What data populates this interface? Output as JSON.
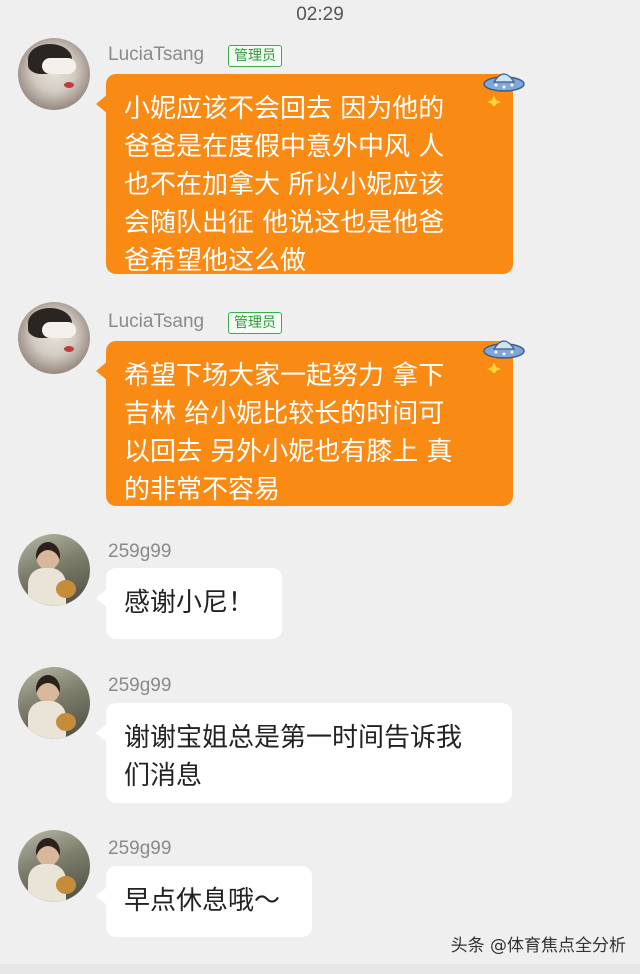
{
  "status_time": "02:29",
  "messages": [
    {
      "sender": "LuciaTsang",
      "badge": "管理员",
      "style": "orange",
      "avatar": "woman-with-eye-mask",
      "lines": [
        "小妮应该不会回去 因为他的",
        "爸爸是在度假中意外中风 人",
        "也不在加拿大 所以小妮应该",
        "会随队出征 他说这也是他爸",
        "爸希望他这么做"
      ]
    },
    {
      "sender": "LuciaTsang",
      "badge": "管理员",
      "style": "orange",
      "avatar": "woman-with-eye-mask",
      "lines": [
        "希望下场大家一起努力 拿下",
        "吉林 给小妮比较长的时间可",
        "以回去 另外小妮也有膝上 真",
        "的非常不容易"
      ]
    },
    {
      "sender": "259g99",
      "style": "white",
      "avatar": "child-with-toy",
      "lines": [
        "感谢小尼！"
      ]
    },
    {
      "sender": "259g99",
      "style": "white",
      "avatar": "child-with-toy",
      "lines": [
        "谢谢宝姐总是第一时间告诉我",
        "们消息"
      ]
    },
    {
      "sender": "259g99",
      "style": "white",
      "avatar": "child-with-toy",
      "lines": [
        "早点休息哦～"
      ]
    }
  ],
  "watermark": "头条 @体育焦点全分析",
  "colors": {
    "orange_bubble": "#f98a14",
    "background": "#efefef",
    "admin_badge": "#3aae48"
  },
  "icons": {
    "admin_decoration": "ufo-sparkle-icon"
  }
}
